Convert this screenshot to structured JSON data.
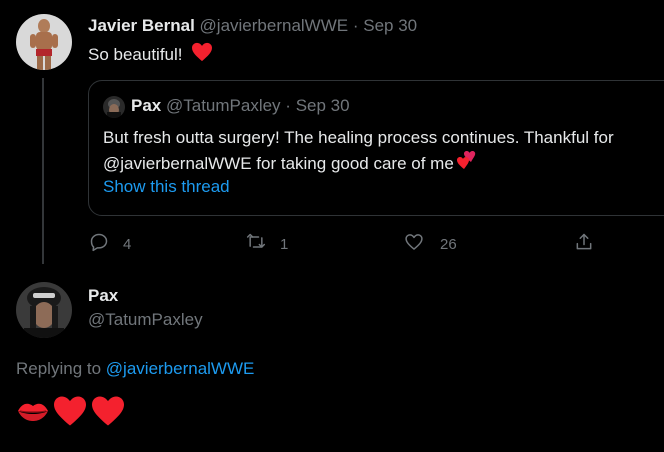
{
  "parent_tweet": {
    "author_name": "Javier Bernal",
    "handle": "@javierbernalWWE",
    "separator": "·",
    "date": "Sep 30",
    "text": "So beautiful!"
  },
  "quoted_tweet": {
    "author_name": "Pax",
    "handle": "@TatumPaxley",
    "separator": "·",
    "date": "Sep 30",
    "line1": "But fresh outta surgery! The healing process continues. Thankful for",
    "line2": "@javierbernalWWE for taking good care of me",
    "show_thread": "Show this thread"
  },
  "actions": {
    "reply_count": "4",
    "retweet_count": "1",
    "like_count": "26"
  },
  "reply_tweet": {
    "author_name": "Pax",
    "handle": "@TatumPaxley",
    "replying_prefix": "Replying to",
    "replying_to": "@javierbernalWWE",
    "emoji_text": "💋❤️❤️"
  },
  "icons": {
    "heart": "heart-icon",
    "reply": "reply-icon",
    "retweet": "retweet-icon",
    "like": "like-icon",
    "share": "share-icon"
  },
  "colors": {
    "background": "#000000",
    "text": "#e7e9ea",
    "muted": "#71767b",
    "link": "#1d9bf0",
    "heart": "#f4212e"
  }
}
